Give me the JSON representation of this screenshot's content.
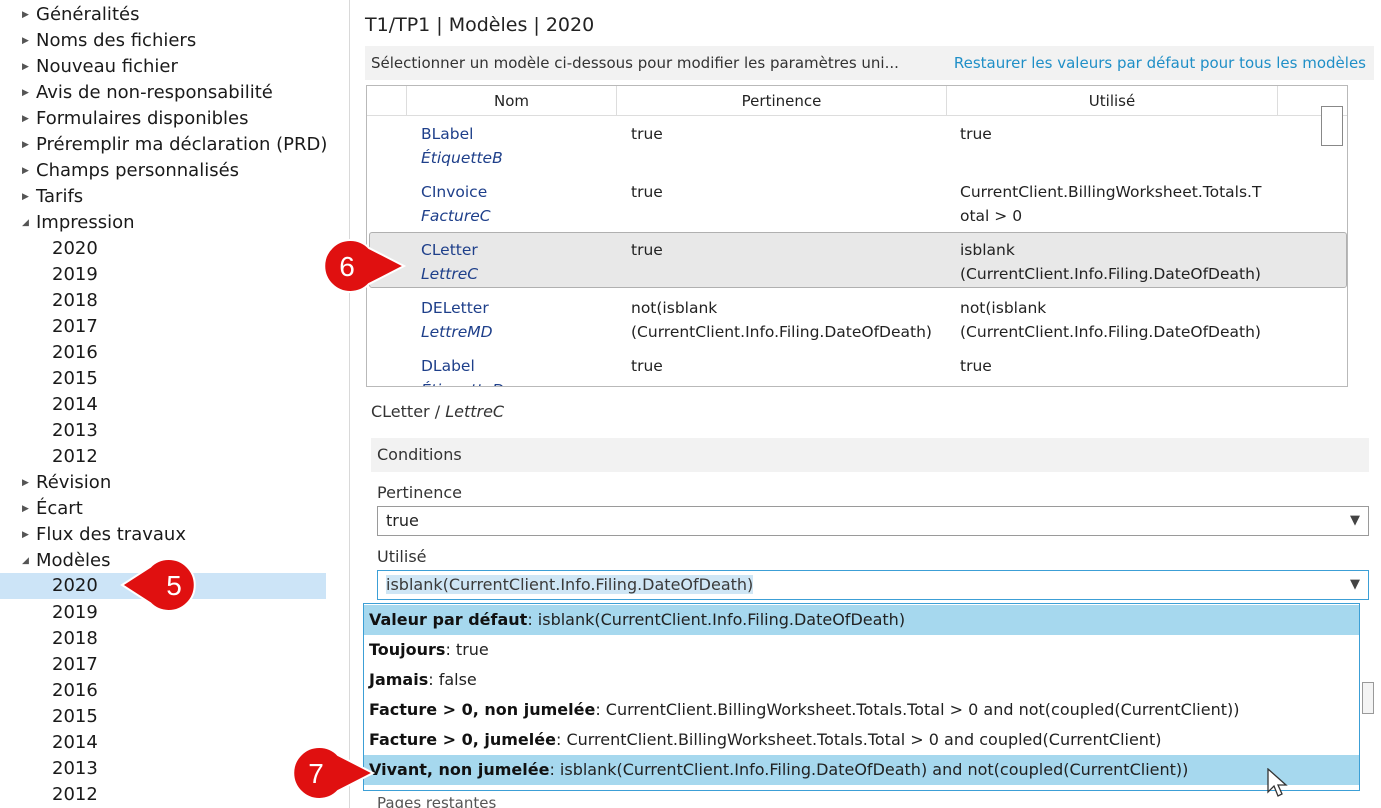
{
  "tree": {
    "items": [
      {
        "label": "Généralités",
        "arrow": "▶"
      },
      {
        "label": "Noms des fichiers",
        "arrow": "▶"
      },
      {
        "label": "Nouveau fichier",
        "arrow": "▶"
      },
      {
        "label": "Avis de non-responsabilité",
        "arrow": "▶"
      },
      {
        "label": "Formulaires disponibles",
        "arrow": "▶"
      },
      {
        "label": "Préremplir ma déclaration (PRD)",
        "arrow": "▶"
      },
      {
        "label": "Champs personnalisés",
        "arrow": "▶"
      },
      {
        "label": "Tarifs",
        "arrow": "▶"
      },
      {
        "label": "Impression",
        "arrow": "◢"
      },
      {
        "label": "Révision",
        "arrow": "▶"
      },
      {
        "label": "Écart",
        "arrow": "▶"
      },
      {
        "label": "Flux des travaux",
        "arrow": "▶"
      },
      {
        "label": "Modèles",
        "arrow": "◢"
      }
    ],
    "impression_years": [
      "2020",
      "2019",
      "2018",
      "2017",
      "2016",
      "2015",
      "2014",
      "2013",
      "2012"
    ],
    "modeles_years": [
      "2020",
      "2019",
      "2018",
      "2017",
      "2016",
      "2015",
      "2014",
      "2013",
      "2012"
    ]
  },
  "header": {
    "title": "T1/TP1 | Modèles | 2020",
    "info_text": "Sélectionner un modèle ci-dessous pour modifier les paramètres uni...",
    "restore_link": "Restaurer les valeurs par défaut pour tous les modèles"
  },
  "grid": {
    "columns": [
      "Nom",
      "Pertinence",
      "Utilisé"
    ],
    "rows": [
      {
        "name": "BLabel",
        "name_fr": "ÉtiquetteB",
        "relevance": "true",
        "used": "true"
      },
      {
        "name": "CInvoice",
        "name_fr": "FactureC",
        "relevance": "true",
        "used": "CurrentClient.BillingWorksheet.Totals.Total > 0"
      },
      {
        "name": "CLetter",
        "name_fr": "LettreC",
        "relevance": "true",
        "used": "isblank (CurrentClient.Info.Filing.DateOfDeath)"
      },
      {
        "name": "DELetter",
        "name_fr": "LettreMD",
        "relevance": "not(isblank (CurrentClient.Info.Filing.DateOfDeath)",
        "used": "not(isblank (CurrentClient.Info.Filing.DateOfDeath)"
      },
      {
        "name": "DLabel",
        "name_fr": "ÉtiquetteD",
        "relevance": "true",
        "used": "true"
      }
    ],
    "used_lines": [
      [
        "true"
      ],
      [
        "CurrentClient.BillingWorksheet.Totals.T",
        "otal > 0"
      ],
      [
        "isblank",
        "(CurrentClient.Info.Filing.DateOfDeath)"
      ],
      [
        "not(isblank",
        "(CurrentClient.Info.Filing.DateOfDeath)"
      ],
      [
        "true"
      ]
    ],
    "relevance_lines": [
      [
        "true"
      ],
      [
        "true"
      ],
      [
        "true"
      ],
      [
        "not(isblank",
        "(CurrentClient.Info.Filing.DateOfDeath)"
      ],
      [
        "true"
      ]
    ]
  },
  "detail": {
    "name": "CLetter",
    "separator": " / ",
    "name_fr": "LettreC",
    "section": "Conditions",
    "relevance_label": "Pertinence",
    "relevance_value": "true",
    "used_label": "Utilisé",
    "used_value": "isblank(CurrentClient.Info.Filing.DateOfDeath)",
    "next_section": "Pages restantes"
  },
  "dropdown": {
    "options": [
      {
        "bold": "Valeur par défaut",
        "text": ": isblank(CurrentClient.Info.Filing.DateOfDeath)"
      },
      {
        "bold": "Toujours",
        "text": ": true"
      },
      {
        "bold": "Jamais",
        "text": ": false"
      },
      {
        "bold": "Facture > 0, non jumelée",
        "text": ": CurrentClient.BillingWorksheet.Totals.Total > 0 and not(coupled(CurrentClient))"
      },
      {
        "bold": "Facture > 0, jumelée",
        "text": ": CurrentClient.BillingWorksheet.Totals.Total > 0 and coupled(CurrentClient)"
      },
      {
        "bold": "Vivant, non jumelée",
        "text": ": isblank(CurrentClient.Info.Filing.DateOfDeath) and not(coupled(CurrentClient))"
      }
    ]
  },
  "callouts": [
    {
      "number": "5"
    },
    {
      "number": "6"
    },
    {
      "number": "7"
    }
  ],
  "colors": {
    "selection": "#cce4f7",
    "dropdown_highlight": "#a6d8ee",
    "link": "#1f8fc7",
    "callout": "#e01010"
  }
}
